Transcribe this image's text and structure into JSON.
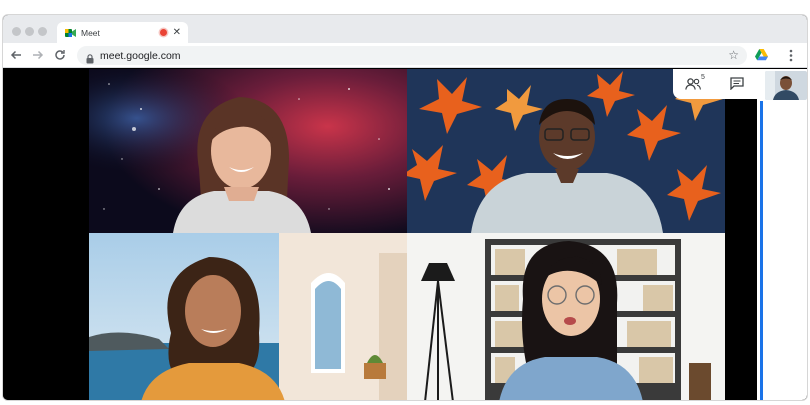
{
  "browser": {
    "tab": {
      "title": "Meet",
      "close_glyph": "✕",
      "recording": true
    },
    "url": "meet.google.com",
    "icons": [
      "back-arrow-icon",
      "forward-arrow-icon",
      "reload-icon",
      "lock-icon",
      "star-icon",
      "drive-icon",
      "menu-dots-icon"
    ]
  },
  "meeting": {
    "participants_count": "5",
    "participants": [
      {
        "background": "space nebula"
      },
      {
        "background": "autumn leaves"
      },
      {
        "background": "seaside terrace"
      },
      {
        "background": "bookshelf office"
      }
    ],
    "controls": [
      "people-icon",
      "chat-icon"
    ]
  },
  "colors": {
    "accent": "#1a73e8",
    "record": "#ea4335"
  }
}
